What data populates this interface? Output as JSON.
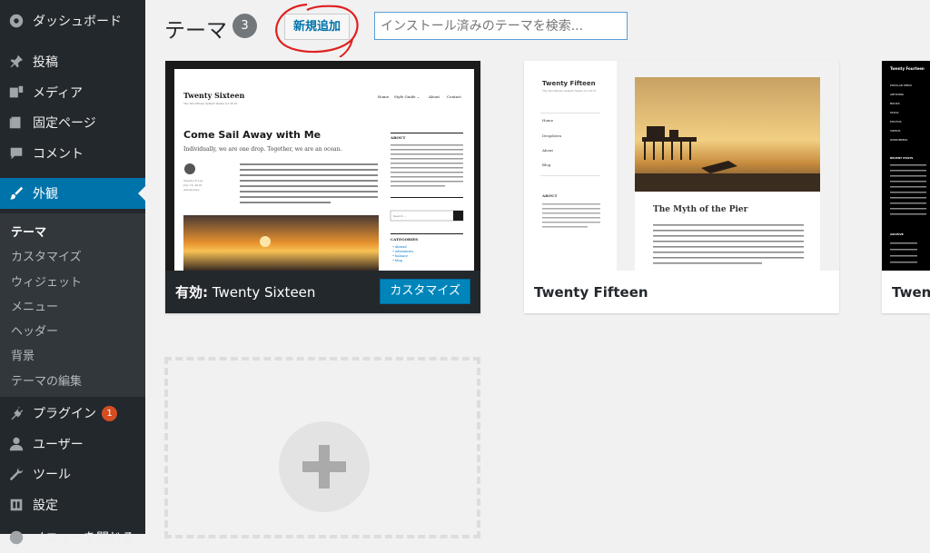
{
  "menu": {
    "dashboard": "ダッシュボード",
    "posts": "投稿",
    "media": "メディア",
    "pages": "固定ページ",
    "comments": "コメント",
    "appearance": "外観",
    "plugins": "プラグイン",
    "plugins_badge": "1",
    "users": "ユーザー",
    "tools": "ツール",
    "settings": "設定",
    "partial_item": "メニューを閉じる"
  },
  "submenu": {
    "themes": "テーマ",
    "customize": "カスタマイズ",
    "widgets": "ウィジェット",
    "menus": "メニュー",
    "header": "ヘッダー",
    "background": "背景",
    "editor": "テーマの編集"
  },
  "header": {
    "title": "テーマ",
    "count": "3",
    "add_new": "新規追加",
    "search_placeholder": "インストール済みのテーマを検索..."
  },
  "themes": {
    "active_prefix": "有効:",
    "active_name": "Twenty Sixteen",
    "customize": "カスタマイズ",
    "second": "Twenty Fifteen",
    "third": "Twent"
  },
  "sixteen_shot": {
    "site_title": "Twenty Sixteen",
    "tagline": "The WordPress default theme for 2016",
    "nav": [
      "Home",
      "Style Guide ⌄",
      "About",
      "Contact"
    ],
    "post_title": "Come Sail Away with Me",
    "lead": "Individually, we are one drop. Together, we are an ocean.",
    "author": "Twenty16 Lee",
    "date": "July 16, 2016",
    "category": "Adventures",
    "widget_about": "ABOUT",
    "widget_categories": "CATEGORIES",
    "categories": [
      "• abroad",
      "• adventures",
      "• balance",
      "• blog"
    ],
    "search_label": "Search ..."
  },
  "fifteen_shot": {
    "site_title": "Twenty Fifteen",
    "tagline": "The WordPress default theme for 2015.",
    "menu": [
      "Home",
      "Dropdown",
      "About",
      "Blog"
    ],
    "about": "ABOUT",
    "post_title": "The Myth of the Pier"
  },
  "fourteen_shot": {
    "site_title": "Twenty Fourteen",
    "menu": [
      "POPULAR MENU",
      "ARTWORK",
      "BOOKS",
      "MUSIC",
      "PHOTOS",
      "VIDEOS",
      "WORDPRESS"
    ],
    "recent": "RECENT POSTS",
    "archive": "ARCHIVE"
  }
}
